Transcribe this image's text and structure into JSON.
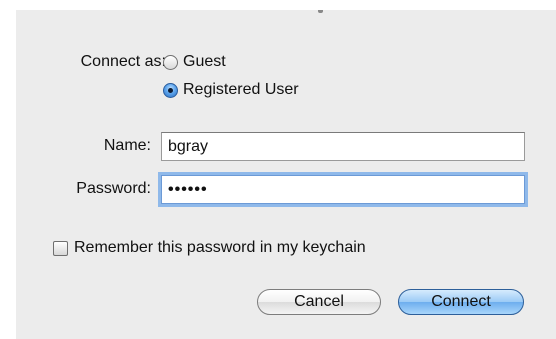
{
  "connect_as": {
    "label": "Connect as:",
    "options": [
      {
        "label": "Guest",
        "selected": false
      },
      {
        "label": "Registered User",
        "selected": true
      }
    ]
  },
  "name": {
    "label": "Name:",
    "value": "bgray"
  },
  "password": {
    "label": "Password:",
    "masked_value": "••••••"
  },
  "remember": {
    "label": "Remember this password in my keychain",
    "checked": false
  },
  "buttons": {
    "cancel": "Cancel",
    "connect": "Connect"
  }
}
